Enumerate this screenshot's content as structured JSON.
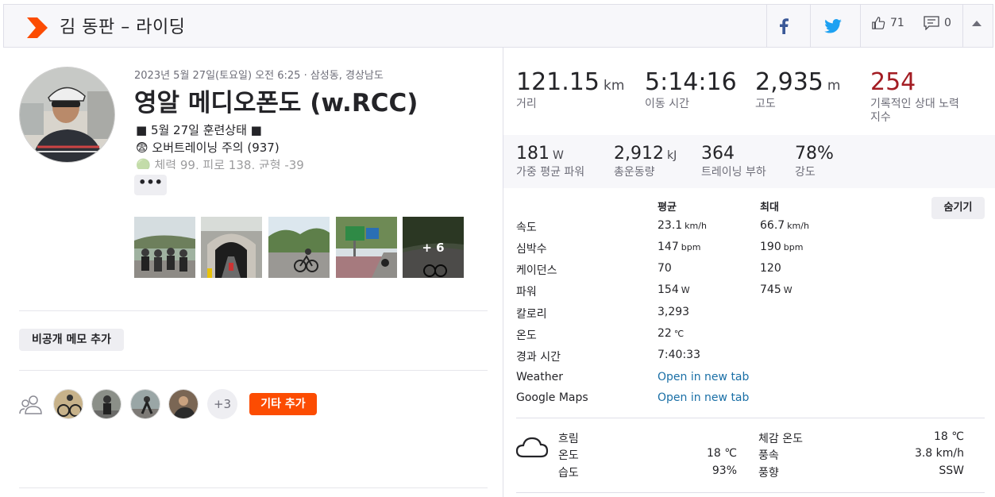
{
  "header": {
    "title": "김 동판 – 라이딩",
    "kudos_count": "71",
    "comment_count": "0"
  },
  "activity": {
    "date_location": "2023년 5월 27일(토요일) 오전 6:25 · 삼성동, 경상남도",
    "title": "영알 메디오폰도 (w.RCC)",
    "description_lines": [
      "■ 5월 27일 훈련상태 ■",
      "😨 오버트레이닝 주의 (937)",
      "🟢 체력 99, 피로 138, 균형 -39"
    ],
    "more_label": "•••",
    "photos_more": "+ 6",
    "memo_button": "비공개 메모 추가",
    "participants_more": "+3",
    "add_others_button": "기타 추가"
  },
  "primary_stats": [
    {
      "value": "121.15",
      "unit": "km",
      "label": "거리"
    },
    {
      "value": "5:14:16",
      "unit": "",
      "label": "이동 시간"
    },
    {
      "value": "2,935",
      "unit": "m",
      "label": "고도"
    },
    {
      "value": "254",
      "unit": "",
      "label": "기록적인 상대 노력 지수"
    }
  ],
  "secondary_stats": [
    {
      "value": "181",
      "unit": "W",
      "label": "가중 평균 파워"
    },
    {
      "value": "2,912",
      "unit": "kJ",
      "label": "총운동량"
    },
    {
      "value": "364",
      "unit": "",
      "label": "트레이닝 부하"
    },
    {
      "value": "78%",
      "unit": "",
      "label": "강도"
    }
  ],
  "details": {
    "avg_header": "평균",
    "max_header": "최대",
    "hide_button": "숨기기",
    "rows": [
      {
        "label": "속도",
        "avg": "23.1",
        "avg_unit": "km/h",
        "max": "66.7",
        "max_unit": "km/h"
      },
      {
        "label": "심박수",
        "avg": "147",
        "avg_unit": "bpm",
        "max": "190",
        "max_unit": "bpm"
      },
      {
        "label": "케이던스",
        "avg": "70",
        "avg_unit": "",
        "max": "120",
        "max_unit": ""
      },
      {
        "label": "파워",
        "avg": "154",
        "avg_unit": "W",
        "max": "745",
        "max_unit": "W"
      },
      {
        "label": "칼로리",
        "avg": "3,293",
        "avg_unit": "",
        "max": "",
        "max_unit": ""
      },
      {
        "label": "온도",
        "avg": "22",
        "avg_unit": "℃",
        "max": "",
        "max_unit": ""
      },
      {
        "label": "경과 시간",
        "avg": "7:40:33",
        "avg_unit": "",
        "max": "",
        "max_unit": ""
      }
    ],
    "links": [
      {
        "label": "Weather",
        "link": "Open in new tab"
      },
      {
        "label": "Google Maps",
        "link": "Open in new tab"
      }
    ]
  },
  "weather": {
    "condition": "흐림",
    "temp_label": "온도",
    "temp_value": "18 ℃",
    "humidity_label": "습도",
    "humidity_value": "93%",
    "feels_label": "체감 온도",
    "feels_value": "18 ℃",
    "wind_label": "풍속",
    "wind_value": "3.8 km/h",
    "dir_label": "풍향",
    "dir_value": "SSW"
  },
  "colors": {
    "brand": "#fc4c02",
    "relative_effort": "#a31c23",
    "link": "#1a6fa6",
    "facebook": "#3b5998",
    "twitter": "#1da1f2"
  }
}
